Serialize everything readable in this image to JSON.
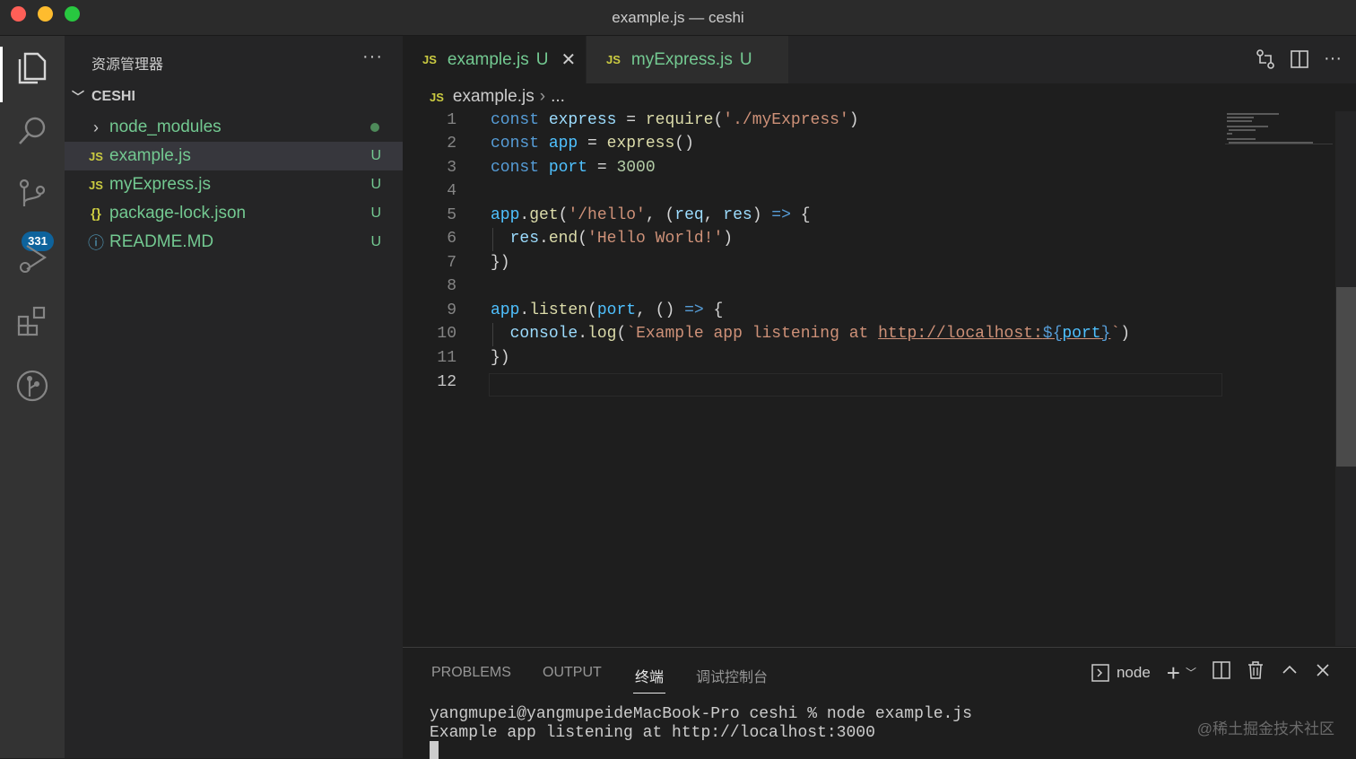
{
  "window": {
    "title": "example.js — ceshi"
  },
  "activity_bar": {
    "items": [
      {
        "icon": "files-icon"
      },
      {
        "icon": "search-icon"
      },
      {
        "icon": "source-control-icon",
        "badge": "331"
      },
      {
        "icon": "run-debug-icon"
      },
      {
        "icon": "extensions-icon"
      },
      {
        "icon": "git-graph-icon"
      }
    ]
  },
  "sidebar": {
    "title": "资源管理器",
    "more": "···",
    "project": "CESHI",
    "files": [
      {
        "name": "node_modules",
        "icon": "›",
        "status": ""
      },
      {
        "name": "example.js",
        "icon": "JS",
        "status": "U"
      },
      {
        "name": "myExpress.js",
        "icon": "JS",
        "status": "U"
      },
      {
        "name": "package-lock.json",
        "icon": "{}",
        "status": "U"
      },
      {
        "name": "README.MD",
        "icon": "ⓘ",
        "status": "U"
      }
    ]
  },
  "tabs": [
    {
      "icon": "JS",
      "label": "example.js",
      "status": "U",
      "close": "✕"
    },
    {
      "icon": "JS",
      "label": "myExpress.js",
      "status": "U"
    }
  ],
  "breadcrumb": {
    "icon": "JS",
    "file": "example.js",
    "sep": "›",
    "more": "..."
  },
  "editor": {
    "line_numbers": [
      "1",
      "2",
      "3",
      "4",
      "5",
      "6",
      "7",
      "8",
      "9",
      "10",
      "11",
      "12"
    ],
    "current_line": "12"
  },
  "panel": {
    "tabs": [
      "PROBLEMS",
      "OUTPUT",
      "终端",
      "调试控制台"
    ],
    "active_tab": "终端",
    "terminal_name": "node",
    "lines": [
      "yangmupei@yangmupeideMacBook-Pro ceshi % node example.js",
      "Example app listening at http://localhost:3000"
    ]
  },
  "watermark": "@稀土掘金技术社区",
  "colors": {
    "accent": "#0e639c",
    "untracked": "#73c991",
    "js_icon": "#cbcb41"
  }
}
